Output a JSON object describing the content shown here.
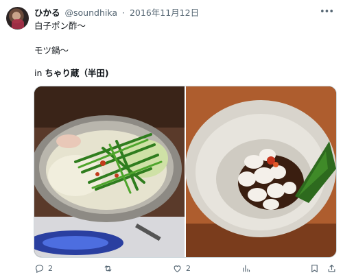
{
  "post": {
    "display_name": "ひかる",
    "handle": "@soundhika",
    "separator": "·",
    "date": "2016年11月12日",
    "more_icon": "more-dots-icon",
    "text_line1": "白子ポン酢〜",
    "text_line2": "モツ鍋〜",
    "location_prefix": "in",
    "location_name": "ちゃり蔵（半田)"
  },
  "media": {
    "images": [
      {
        "subject": "motsu-nabe-hotpot-photo"
      },
      {
        "subject": "shirako-ponzu-photo"
      }
    ]
  },
  "actions": {
    "reply_count": "2",
    "retweet_count": "",
    "like_count": "2",
    "views_count": "",
    "icons": [
      "reply-icon",
      "retweet-icon",
      "like-icon",
      "views-icon",
      "bookmark-icon",
      "share-icon"
    ]
  }
}
